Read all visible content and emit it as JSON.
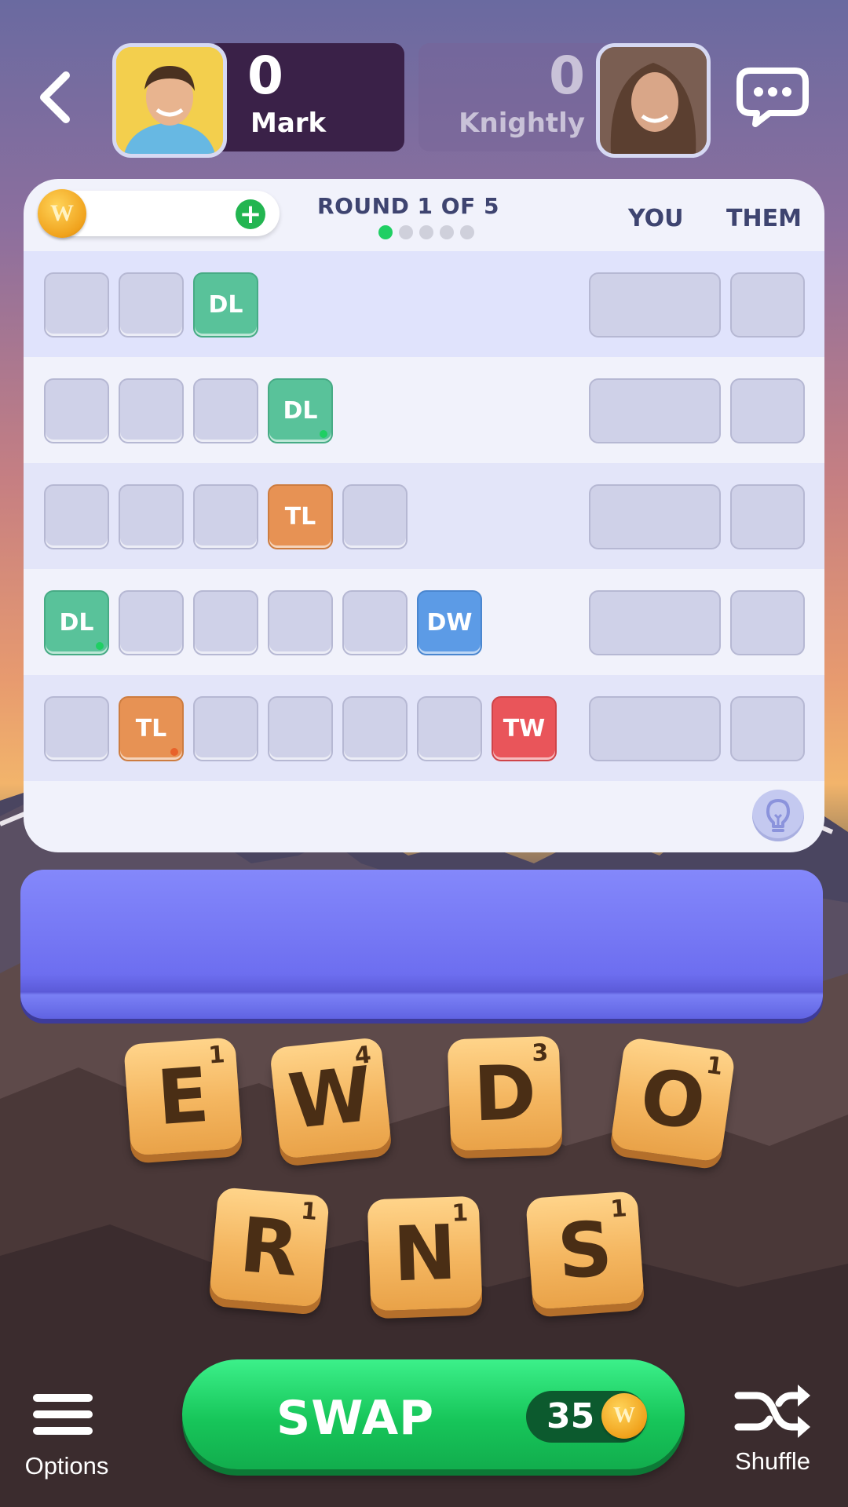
{
  "players": {
    "me": {
      "name": "Mark",
      "score": "0"
    },
    "opponent": {
      "name": "Knightly",
      "score": "0"
    }
  },
  "board": {
    "round_label": "ROUND 1 OF 5",
    "rounds_total": 5,
    "current_round": 1,
    "col_you": "YOU",
    "col_them": "THEM",
    "rows": [
      {
        "cells": [
          "",
          "",
          "DL"
        ]
      },
      {
        "cells": [
          "",
          "",
          "",
          "DL"
        ]
      },
      {
        "cells": [
          "",
          "",
          "",
          "TL",
          ""
        ]
      },
      {
        "cells": [
          "DL",
          "",
          "",
          "",
          "",
          "DW"
        ]
      },
      {
        "cells": [
          "",
          "TL",
          "",
          "",
          "",
          "",
          "TW"
        ]
      }
    ]
  },
  "rack": {
    "tiles": [
      {
        "letter": "E",
        "points": "1"
      },
      {
        "letter": "W",
        "points": "4"
      },
      {
        "letter": "D",
        "points": "3"
      },
      {
        "letter": "O",
        "points": "1"
      },
      {
        "letter": "R",
        "points": "1"
      },
      {
        "letter": "N",
        "points": "1"
      },
      {
        "letter": "S",
        "points": "1"
      }
    ]
  },
  "bottom": {
    "options_label": "Options",
    "swap_label": "SWAP",
    "swap_cost": "35",
    "shuffle_label": "Shuffle"
  },
  "colors": {
    "dl": "#59c29a",
    "tl": "#e79254",
    "dw": "#5c9be6",
    "tw": "#e9555a",
    "accent_green": "#17c65a",
    "tray": "#6d6ef0"
  },
  "icons": [
    "back-arrow-icon",
    "chat-bubble-icon",
    "coin-icon",
    "plus-icon",
    "lightbulb-icon",
    "menu-icon",
    "shuffle-icon"
  ]
}
